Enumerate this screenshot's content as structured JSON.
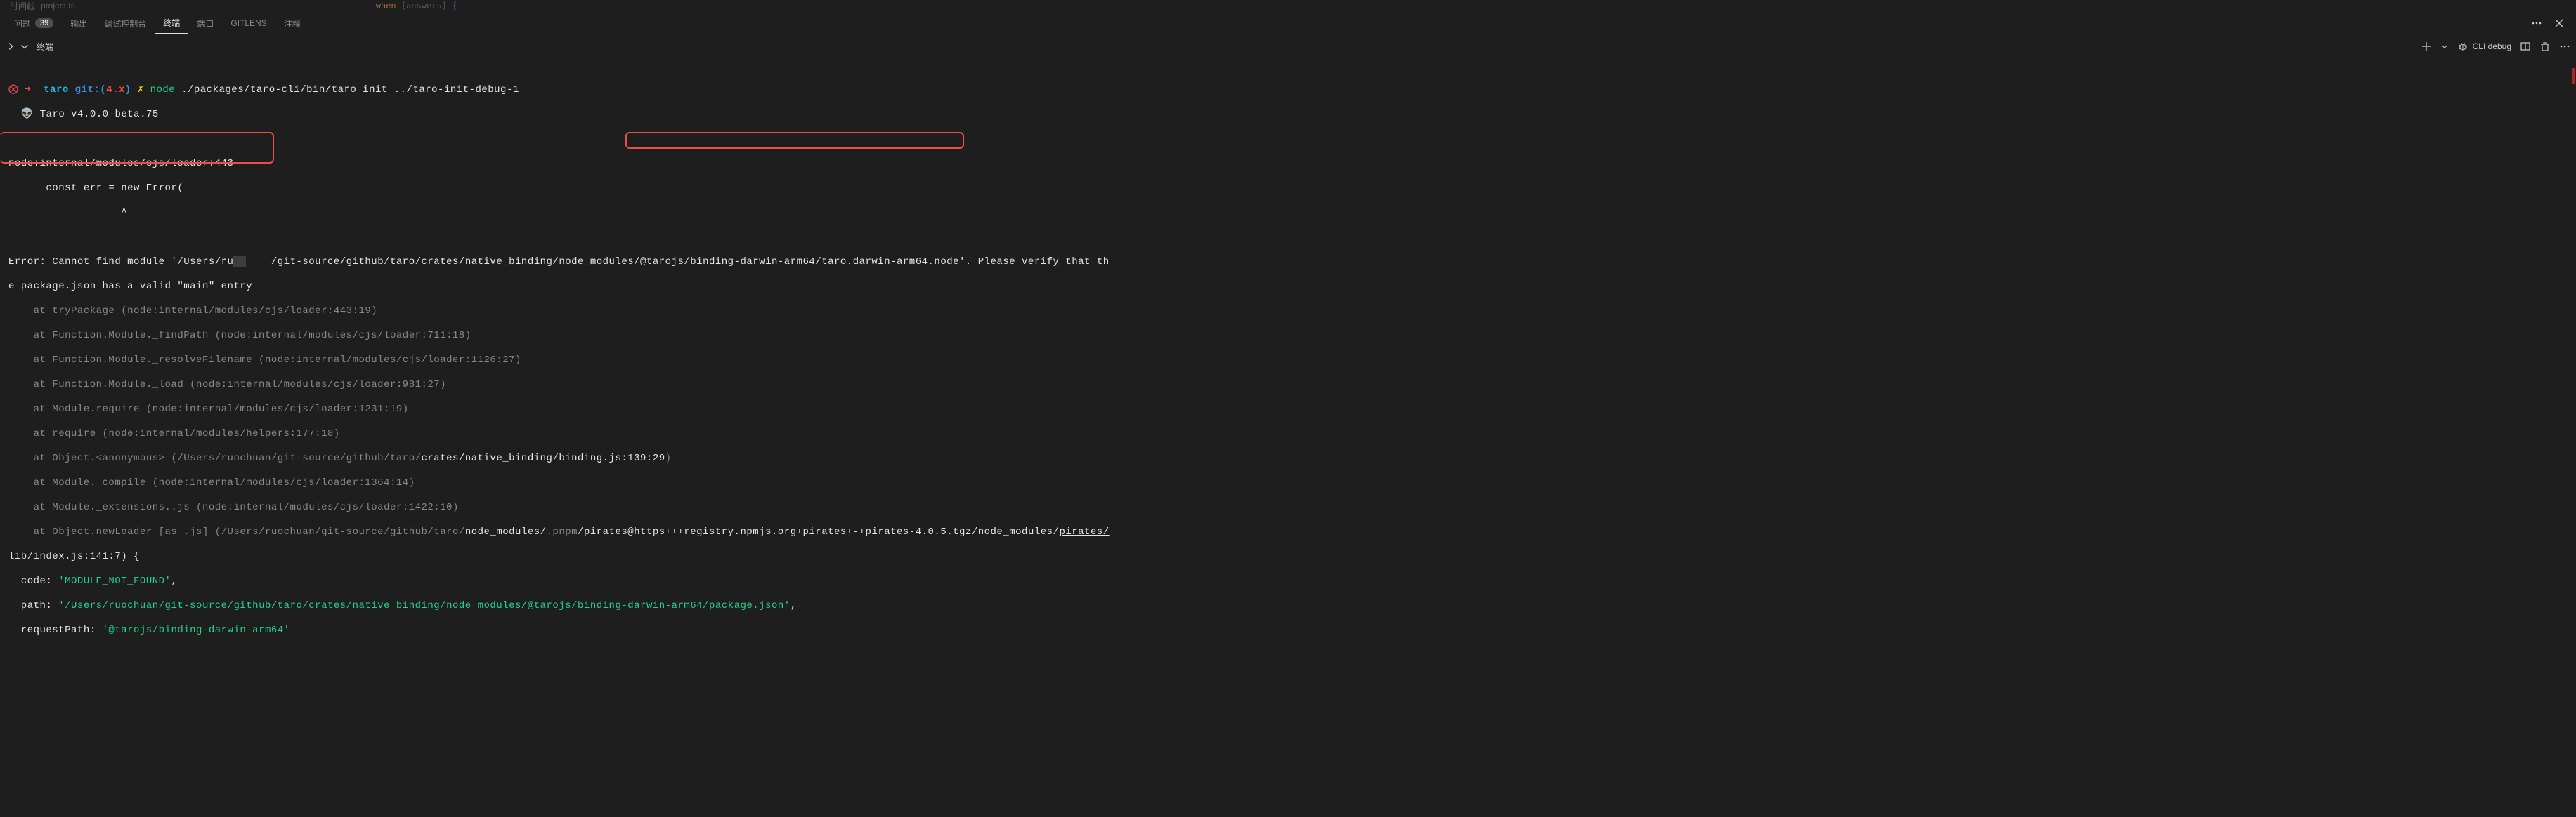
{
  "editorHint": {
    "timeline": "时间线",
    "project": "project.ts",
    "code_kw": "when",
    "code_var": "[answers]"
  },
  "tabs": {
    "problems": "问题",
    "problemsBadge": "39",
    "output": "输出",
    "debugConsole": "调试控制台",
    "terminal": "终端",
    "ports": "端口",
    "gitlens": "GITLENS",
    "comments": "注释"
  },
  "terminalHeader": {
    "title": "终端",
    "launch": "CLI debug"
  },
  "prompt": {
    "errIcon": "⨂",
    "arrow": "➜",
    "repo": "taro",
    "gitLabel": "git:(",
    "branch": "4.x",
    "gitClose": ")",
    "dirty": "✗",
    "cmd": "node",
    "arg1": "./packages/taro-cli/bin/taro",
    "arg2": " init ../taro-init-debug-1"
  },
  "banner": {
    "icon": "👽",
    "text": " Taro v4.0.0-beta.75"
  },
  "err": {
    "l1": "node:internal/modules/cjs/loader:443",
    "l2": "      const err = new Error(",
    "l3": "                  ^",
    "em1a": "Error: Cannot find module '/Users/ru",
    "em1b": "    /git-source/github/taro/crates/native_binding/node_modules/@tarojs/binding-darwin-arm64/taro.darwin-arm64.node'. Please verify that th",
    "em2": "e package.json has a valid \"main\" entry",
    "s1": "    at tryPackage (node:internal/modules/cjs/loader:443:19)",
    "s2": "    at Function.Module._findPath (node:internal/modules/cjs/loader:711:18)",
    "s3": "    at Function.Module._resolveFilename (node:internal/modules/cjs/loader:1126:27)",
    "s4": "    at Function.Module._load (node:internal/modules/cjs/loader:981:27)",
    "s5": "    at Module.require (node:internal/modules/cjs/loader:1231:19)",
    "s6": "    at require (node:internal/modules/helpers:177:18)",
    "s7a": "    at Object.<anonymous> (/Users/ruochuan/git-source/github/taro/",
    "s7b": "crates/native_binding/binding.js:139:29",
    "s7c": ")",
    "s8": "    at Module._compile (node:internal/modules/cjs/loader:1364:14)",
    "s9": "    at Module._extensions..js (node:internal/modules/cjs/loader:1422:10)",
    "s10a": "    at Object.newLoader [as .js] (/Users/ruochuan/git-source/github/taro/",
    "s10b": "node_modules/",
    "s10c": ".pnpm",
    "s10d": "/pirates@https+++registry.npmjs.org+pirates+-+pirates-4.0.5.tgz/node_modules/",
    "s10e": "pirates/",
    "s11": "lib/index.js:141:7) {",
    "codeK": "  code: ",
    "codeV": "'MODULE_NOT_FOUND'",
    "comma": ",",
    "pathK": "  path: ",
    "pathV": "'/Users/ruochuan/git-source/github/taro/crates/native_binding/node_modules/@tarojs/binding-darwin-arm64/package.json'",
    "reqK": "  requestPath: ",
    "reqV": "'@tarojs/binding-darwin-arm64'"
  }
}
